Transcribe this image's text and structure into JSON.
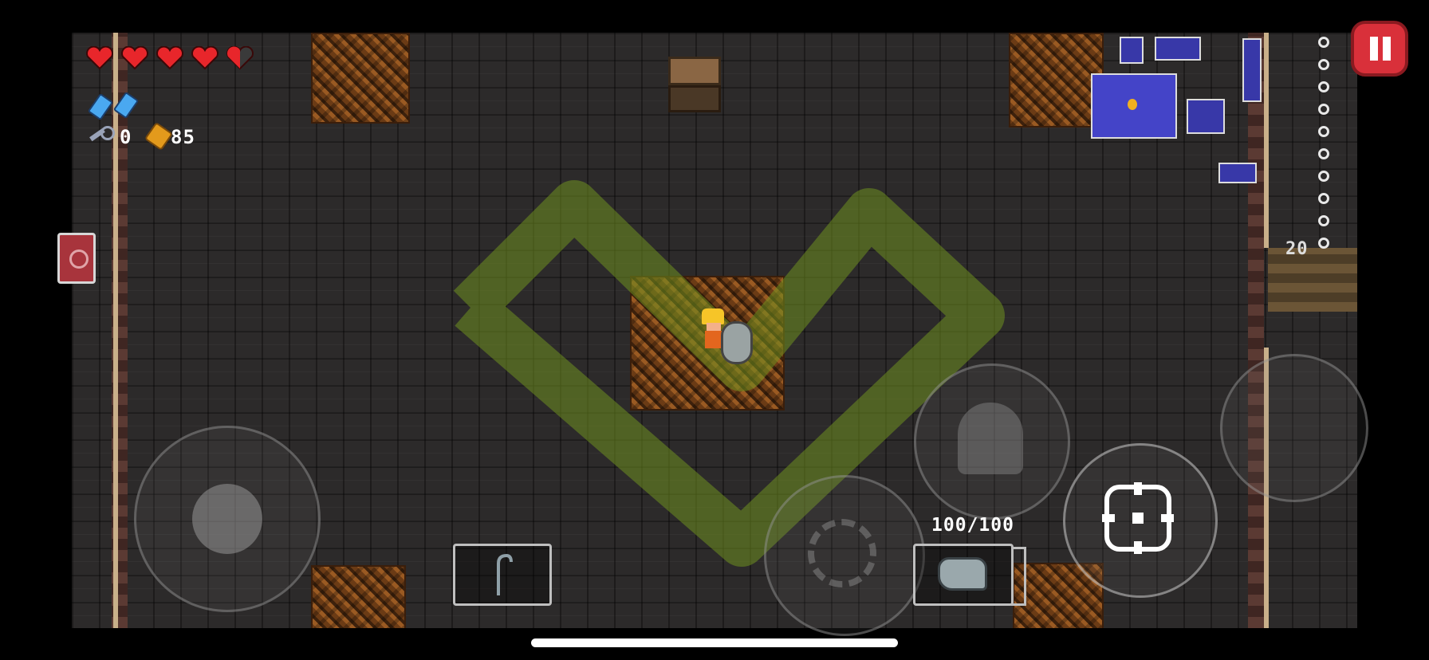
{
  "hud": {
    "hearts": [
      1,
      1,
      1,
      1,
      0.5
    ],
    "blanks": 2,
    "keys": "0",
    "shells": "85",
    "combo_counter": "20",
    "ammo": "100/100"
  },
  "colors": {
    "heart": "#e8262b",
    "blank": "#4aa8f0",
    "minimap": "#4444c8",
    "pause": "#d9303a",
    "trail": "#6f8f1f"
  },
  "icons": {
    "keys": "key-icon",
    "shells": "shell-currency-icon",
    "pause": "pause-icon",
    "item": "cane-item-icon",
    "gun": "gun-icon",
    "aim": "crosshair-icon",
    "dodge": "dodge-roll-icon",
    "interact": "interact-icon",
    "book": "book-item-icon"
  },
  "resources_list_count": 10
}
